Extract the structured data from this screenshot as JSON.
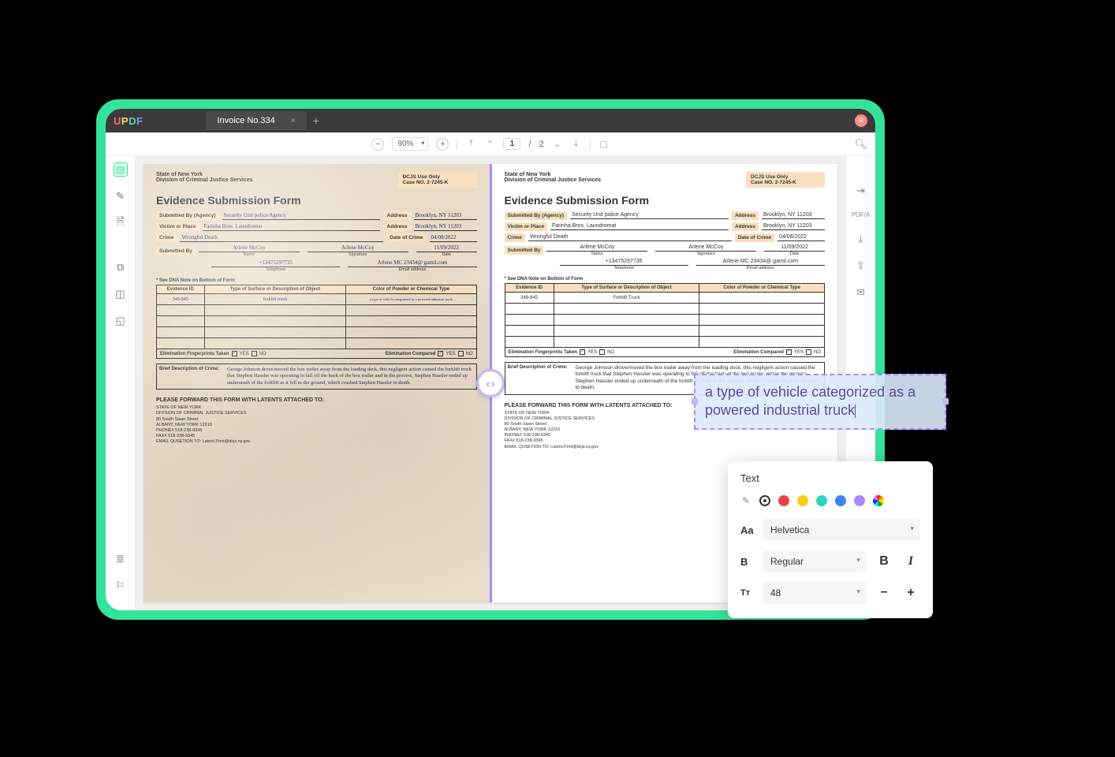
{
  "titlebar": {
    "logo": "UPDF",
    "tab_label": "Invoice No.334",
    "tab_close": "×",
    "tab_add": "+",
    "avatar": "R"
  },
  "toolbar": {
    "zoom_out": "−",
    "zoom_in": "+",
    "zoom_value": "90%",
    "page_current": "1",
    "page_sep": "/",
    "page_total": "2"
  },
  "doc": {
    "state": "State of New York",
    "division": "Division of Criminal Justice Services",
    "case_label1": "DCJS Use Only",
    "case_label2": "Case NO.  2-7245-K",
    "title": "Evidence Submission Form",
    "labels": {
      "submitted_by_agency": "Submitted By (Agency)",
      "address": "Address",
      "victim": "Victim or Place",
      "crime": "Crime",
      "date_crime": "Date of Crime",
      "submitted_by": "Submitted By",
      "name": "Name",
      "signature": "Signature",
      "date": "Date",
      "telephone": "Telephone",
      "email": "Email address",
      "dna_note": "* See DNA Note on Bottom of Form",
      "col_evidence": "Evidence ID",
      "col_surface": "Type of Surface or Description of Object",
      "col_powder": "Color of Powder or Chemical Type",
      "elim_taken": "Elimination Fingerprints Taken",
      "elim_comp": "Elimination Compared",
      "yes": "YES",
      "no": "NO",
      "check": "✓",
      "brief_desc": "Brief Description of Crime:",
      "forward": "PLEASE FORWARD THIS FORM WITH LATENTS ATTACHED TO:"
    },
    "scanned": {
      "agency": "Security Unit police Agency",
      "addr1": "Brooklyn, NY 11203",
      "victim": "Farinha Bros. Laundromat",
      "addr2": "Brooklyn, NY 11203",
      "crime": "Wrongful Death",
      "date_crime": "04/08/2022",
      "name": "Arlene McCoy",
      "signature": "Arlene McCoy",
      "date": "11/09/2022",
      "phone": "+13475297735",
      "email": "Arlene MC 23434@ gamil.com",
      "evid_id": "349-845",
      "evid_surf": "forklift truck",
      "evid_chem": "a type of vehicle categorized as a powered industrial truck",
      "desc": "George Johnson drove/moved the box trailer away from the loading deck, this negligent action caused the forklift truck that Stephen Hassler was operating to fall off the back of the box trailer and in the process, Stephen Hassler ended up underneath of the forklift as it fell to the ground, which crushed Stephen Hassler to death."
    },
    "clean": {
      "agency": "Security Unit police Agency",
      "addr1": "Brooklyn, NY 11203",
      "victim": "Farinha Bros. Laundromat",
      "addr2": "Brooklyn, NY 11203",
      "crime": "Wrongful Death",
      "date_crime": "04/08/2022",
      "name": "Arlene McCoy",
      "signature": "Arlene McCoy",
      "date": "11/09/2022",
      "phone": "+13475297735",
      "email": "Arlene MC 23434@ gamil.com",
      "evid_id": "349-845",
      "evid_surf": "Forklift Truck",
      "desc": "George Johnson drove/moved the box trailer away from the loading dock, this negligent action caused the forklift truck that Stephen Hassler was operating to fall off the back of the box trailer and in the process, Stephen Hassler ended up underneath of the forklift as it fell to the ground, which crushed Stephen Hassler to death."
    },
    "address_block": {
      "l1": "STATE OF NEW YORK",
      "l2": "DIVISION OF CRIMINAL JUSTICE SERVICES",
      "l3": "80 South Swan Street",
      "l4": "ALBANY, NEW YORK 12210",
      "l5": "PHONE# 518-238-9345",
      "l6": "FAX# 518-238-9345",
      "l7": "EMAIL QUSETION TO: Latent.Print@dcjs.ny.gov"
    }
  },
  "edit": {
    "text": "a type of vehicle categorized as a powered industrial truck"
  },
  "panel": {
    "title": "Text",
    "colors": [
      "#000000",
      "#ef4444",
      "#facc15",
      "#2dd4bf",
      "#3b82f6",
      "#a78bfa"
    ],
    "font_label": "Aa",
    "font_value": "Helvetica",
    "weight_label": "B",
    "weight_value": "Regular",
    "bold": "B",
    "italic": "I",
    "size_label": "Tт",
    "size_value": "48",
    "size_minus": "−",
    "size_plus": "+"
  }
}
